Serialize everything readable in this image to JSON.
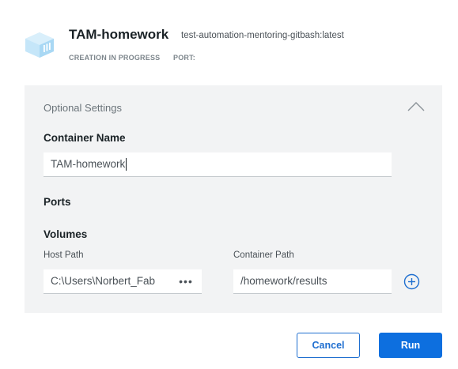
{
  "header": {
    "title": "TAM-homework",
    "image": "test-automation-mentoring-gitbash:latest",
    "status": "CREATION IN PROGRESS",
    "port_label": "PORT:",
    "logo_icon": "container-cube-icon"
  },
  "settings": {
    "title": "Optional Settings",
    "collapse_icon": "chevron-up-icon",
    "container_name": {
      "label": "Container Name",
      "value": "TAM-homework"
    },
    "ports": {
      "label": "Ports"
    },
    "volumes": {
      "label": "Volumes",
      "host_path_label": "Host Path",
      "host_path_value": "C:\\Users\\Norbert_Fab",
      "host_more": "•••",
      "container_path_label": "Container Path",
      "container_path_value": "/homework/results",
      "add_icon": "plus-circle-icon"
    }
  },
  "actions": {
    "cancel": "Cancel",
    "run": "Run"
  },
  "colors": {
    "accent": "#0d6fdf",
    "logo": "#bfe3f8",
    "panel_bg": "#f2f3f4"
  }
}
